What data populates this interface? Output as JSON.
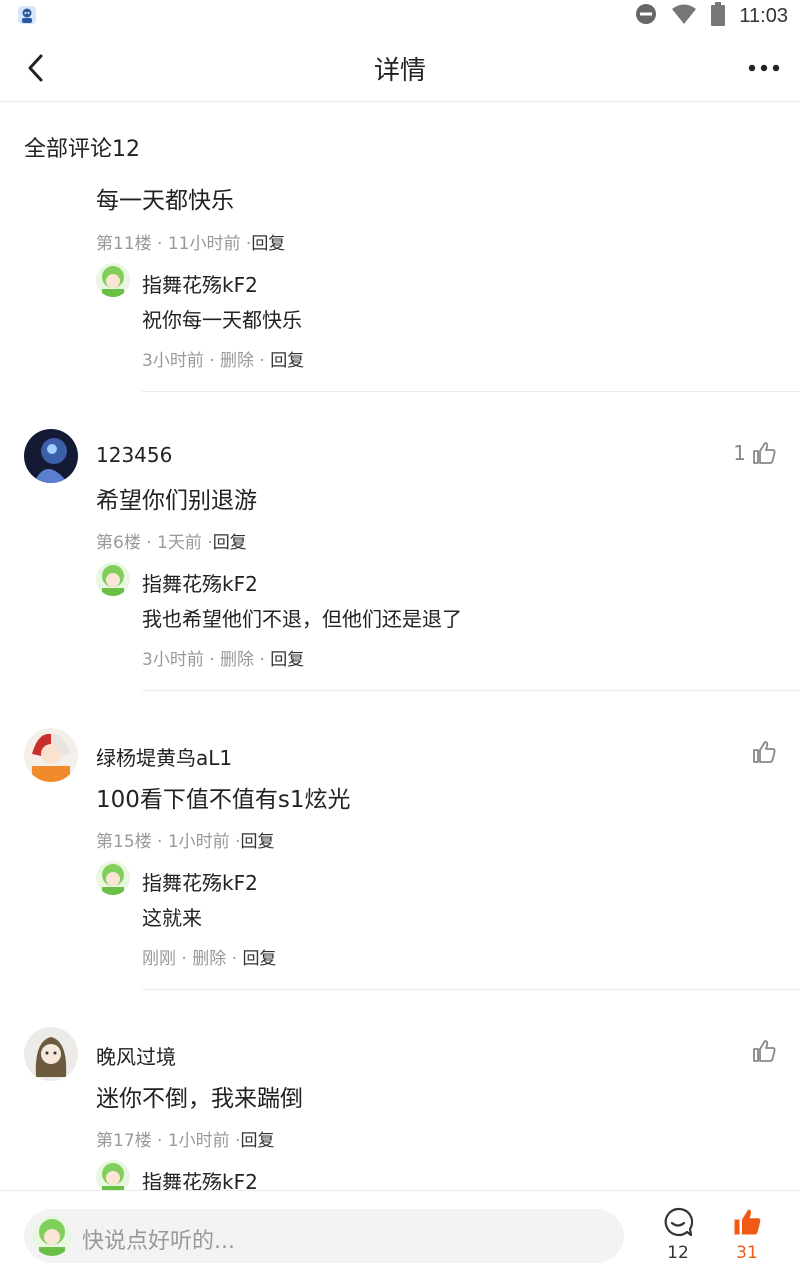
{
  "status": {
    "time": "11:03"
  },
  "header": {
    "title": "详情"
  },
  "section": {
    "title": "全部评论12"
  },
  "comments": [
    {
      "user": "",
      "text": "每一天都快乐",
      "meta": {
        "floor": "第11楼",
        "time": "11小时前",
        "reply": "回复"
      },
      "reply": {
        "user": "指舞花殇kF2",
        "text": "祝你每一天都快乐",
        "time": "3小时前",
        "delete": "删除",
        "reply": "回复"
      }
    },
    {
      "user": "123456",
      "likes": "1",
      "text": "希望你们别退游",
      "meta": {
        "floor": "第6楼",
        "time": "1天前",
        "reply": "回复"
      },
      "reply": {
        "user": "指舞花殇kF2",
        "text": "我也希望他们不退，但他们还是退了",
        "time": "3小时前",
        "delete": "删除",
        "reply": "回复"
      }
    },
    {
      "user": "绿杨堤黄鸟aL1",
      "likes": "",
      "text": "100看下值不值有s1炫光",
      "meta": {
        "floor": "第15楼",
        "time": "1小时前",
        "reply": "回复"
      },
      "reply": {
        "user": "指舞花殇kF2",
        "text": "这就来",
        "time": "刚刚",
        "delete": "删除",
        "reply": "回复"
      }
    },
    {
      "user": "晚风过境",
      "likes": "",
      "text": "迷你不倒，我来踹倒",
      "meta": {
        "floor": "第17楼",
        "time": "1小时前",
        "reply": "回复"
      },
      "reply": {
        "user": "指舞花殇kF2"
      }
    }
  ],
  "bottom": {
    "placeholder": "快说点好听的...",
    "comment_count": "12",
    "like_count": "31"
  },
  "colors": {
    "accent": "#f05a14",
    "muted": "#999999"
  }
}
